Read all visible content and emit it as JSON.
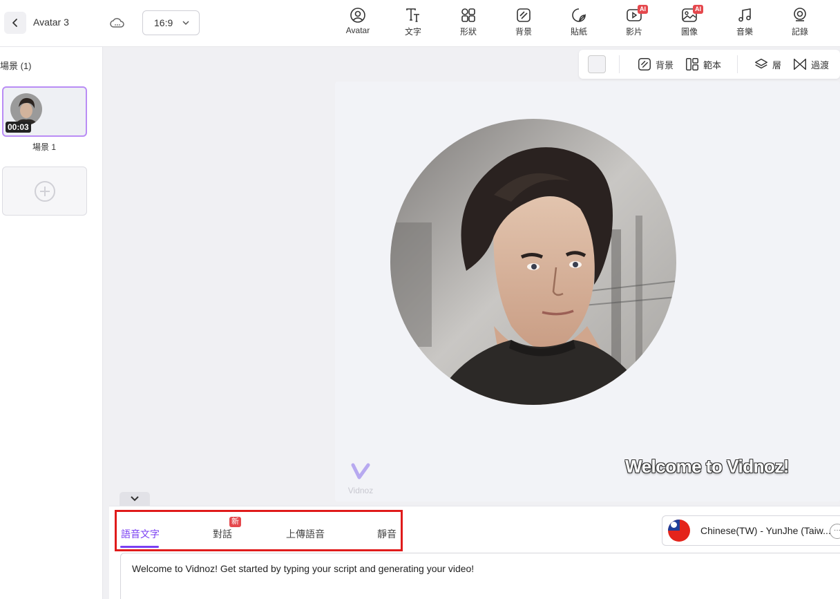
{
  "header": {
    "project_title": "Avatar 3",
    "aspect_ratio": "16:9",
    "tools": [
      {
        "label": "Avatar",
        "icon": "avatar-icon",
        "ai": false
      },
      {
        "label": "文字",
        "icon": "text-icon",
        "ai": false
      },
      {
        "label": "形狀",
        "icon": "shapes-icon",
        "ai": false
      },
      {
        "label": "背景",
        "icon": "background-icon",
        "ai": false
      },
      {
        "label": "貼紙",
        "icon": "sticker-icon",
        "ai": false
      },
      {
        "label": "影片",
        "icon": "video-icon",
        "ai": true
      },
      {
        "label": "圖像",
        "icon": "image-icon",
        "ai": true
      },
      {
        "label": "音樂",
        "icon": "music-icon",
        "ai": false
      },
      {
        "label": "記錄",
        "icon": "record-icon",
        "ai": false
      }
    ],
    "ai_badge": "AI"
  },
  "scenes": {
    "heading": "場景 (1)",
    "items": [
      {
        "label": "場景 1",
        "duration": "00:03"
      }
    ]
  },
  "canvas_toolbar": {
    "background_label": "背景",
    "template_label": "範本",
    "layer_label": "層",
    "transition_label": "過渡"
  },
  "canvas": {
    "caption": "Welcome to Vidnoz!",
    "watermark": "Vidnoz"
  },
  "bottom_panel": {
    "tabs": [
      {
        "label": "語音文字",
        "active": true
      },
      {
        "label": "對話",
        "badge": "新"
      },
      {
        "label": "上傳語音"
      },
      {
        "label": "靜音"
      }
    ],
    "voice": "Chinese(TW) - YunJhe (Taiw...",
    "script_text": "Welcome to Vidnoz! Get started by typing your script and generating your video!"
  },
  "colors": {
    "accent": "#7a3ff2",
    "highlight_box": "#e01b1b",
    "badge": "#e5484d"
  }
}
